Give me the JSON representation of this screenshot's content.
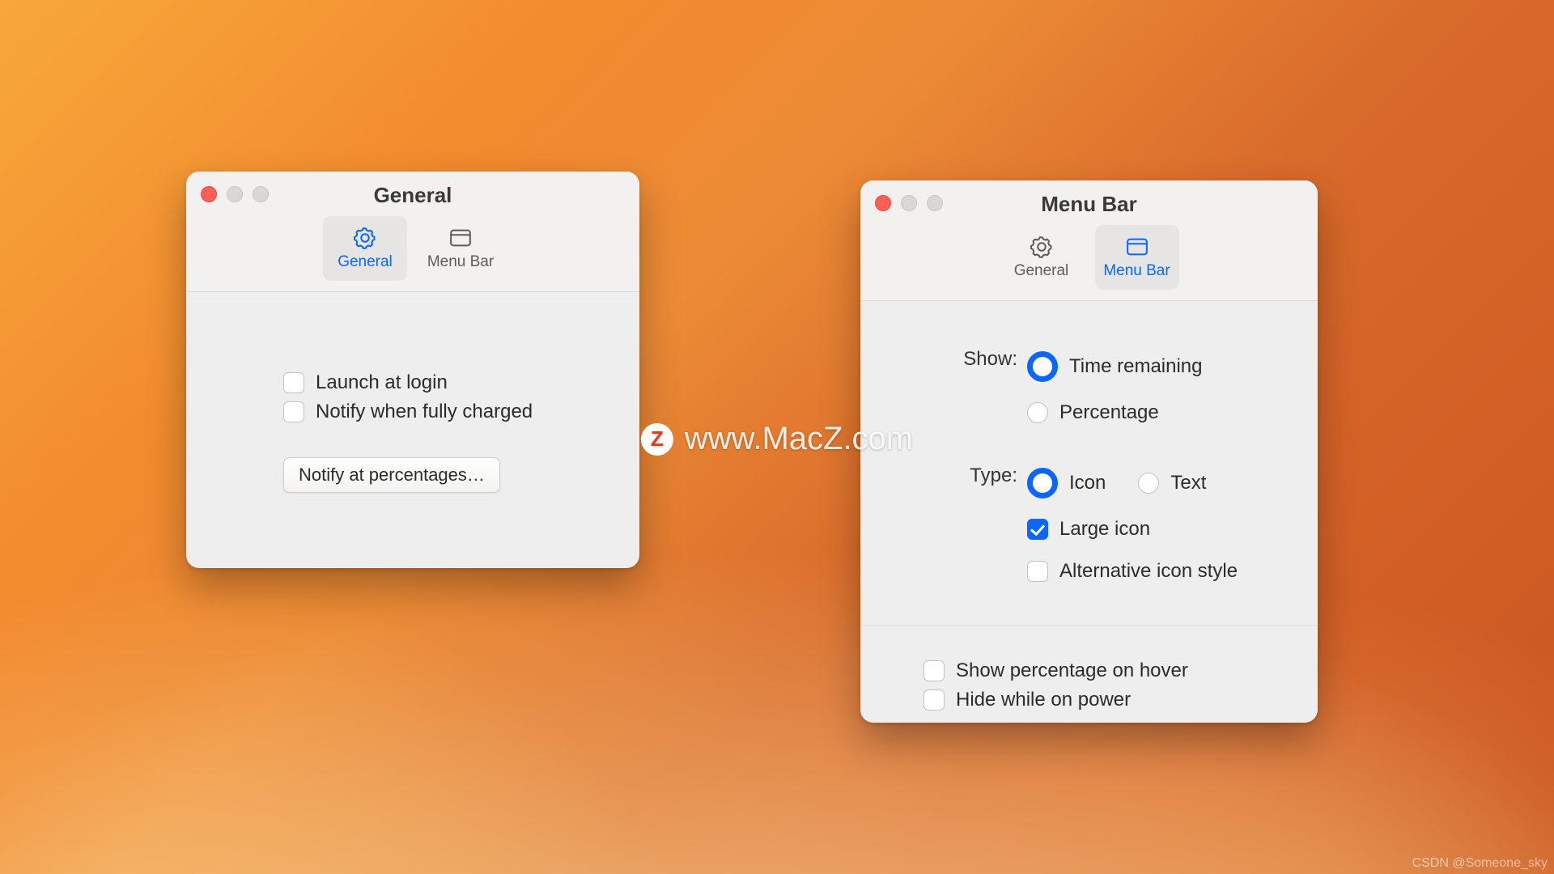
{
  "watermark": {
    "text": "www.MacZ.com",
    "logo_letter": "Z"
  },
  "credit": "CSDN @Someone_sky",
  "window1": {
    "title": "General",
    "tabs": [
      {
        "label": "General",
        "selected": true
      },
      {
        "label": "Menu Bar",
        "selected": false
      }
    ],
    "options": {
      "launch_at_login": {
        "label": "Launch at login",
        "checked": false
      },
      "notify_fully_charged": {
        "label": "Notify when fully charged",
        "checked": false
      }
    },
    "button_label": "Notify at percentages…"
  },
  "window2": {
    "title": "Menu Bar",
    "tabs": [
      {
        "label": "General",
        "selected": false
      },
      {
        "label": "Menu Bar",
        "selected": true
      }
    ],
    "show": {
      "label": "Show:",
      "options": [
        {
          "label": "Time remaining",
          "selected": true
        },
        {
          "label": "Percentage",
          "selected": false
        }
      ]
    },
    "type": {
      "label": "Type:",
      "options": [
        {
          "label": "Icon",
          "selected": true
        },
        {
          "label": "Text",
          "selected": false
        }
      ],
      "large_icon": {
        "label": "Large icon",
        "checked": true
      },
      "alt_style": {
        "label": "Alternative icon style",
        "checked": false
      }
    },
    "extras": {
      "show_percentage_hover": {
        "label": "Show percentage on hover",
        "checked": false
      },
      "hide_on_power": {
        "label": "Hide while on power",
        "checked": false
      }
    }
  }
}
